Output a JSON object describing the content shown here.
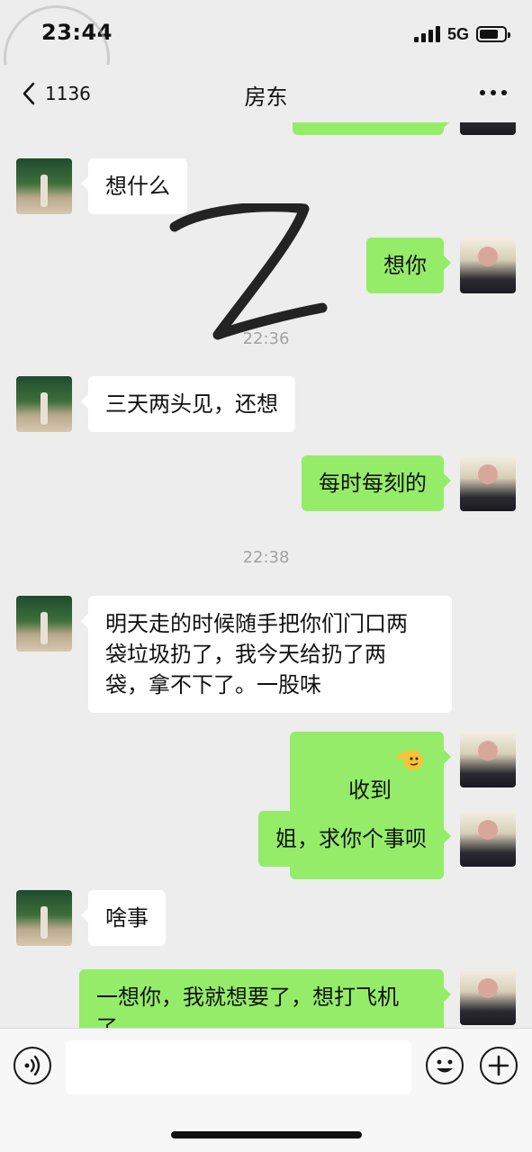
{
  "status_bar": {
    "time": "23:44",
    "network": "5G"
  },
  "header": {
    "back_count": "1136",
    "title": "房东"
  },
  "messages": [
    {
      "from": "me",
      "text": "",
      "partial": true
    },
    {
      "from": "her",
      "text": "想什么"
    },
    {
      "from": "me",
      "text": "想你"
    },
    {
      "type": "time",
      "text": "22:36"
    },
    {
      "from": "her",
      "text": "三天两头见，还想"
    },
    {
      "from": "me",
      "text": "每时每刻的"
    },
    {
      "type": "time",
      "text": "22:38"
    },
    {
      "from": "her",
      "text": "明天走的时候随手把你们门口两\n袋垃圾扔了，我今天给扔了两\n袋，拿不下了。一股味"
    },
    {
      "from": "me",
      "text": "收到",
      "emoji": "salute-emoji"
    },
    {
      "from": "me",
      "text": "姐，求你个事呗"
    },
    {
      "from": "her",
      "text": "啥事"
    },
    {
      "from": "me",
      "text": "一想你，我就想要了，想打飞机\n了"
    }
  ],
  "input": {
    "placeholder": "",
    "value": ""
  },
  "icons": {
    "back": "chevron-left-icon",
    "more": "more-icon",
    "voice": "voice-icon",
    "emoji": "emoji-icon",
    "plus": "plus-icon"
  },
  "colors": {
    "outgoing_bubble": "#95ec69",
    "incoming_bubble": "#ffffff",
    "background": "#ededed"
  }
}
